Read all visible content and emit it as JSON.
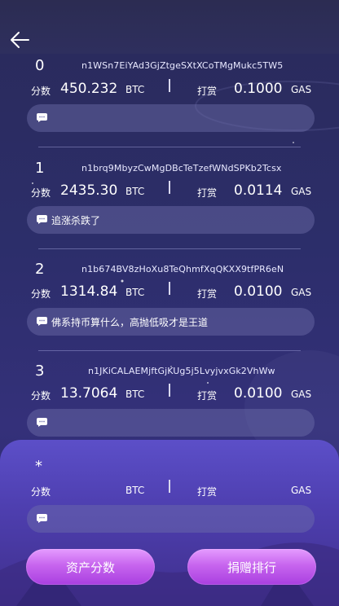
{
  "nav": {
    "back_icon": "arrow-left-icon"
  },
  "labels": {
    "score": "分数",
    "tip": "打赏",
    "btc": "BTC",
    "gas": "GAS"
  },
  "entries": [
    {
      "rank": "0",
      "address": "n1WSn7EiYAd3GjZtgeSXtXCoTMgMukc5TW5",
      "score": "450.232",
      "tip": "0.1000",
      "comment": ""
    },
    {
      "rank": "1",
      "address": "n1brq9MbyzCwMgDBcTeTzefWNdSPKb2Tcsx",
      "score": "2435.30",
      "tip": "0.0114",
      "comment": "追涨杀跌了"
    },
    {
      "rank": "2",
      "address": "n1b674BV8zHoXu8TeQhmfXqQKXX9tfPR6eN",
      "score": "1314.84",
      "tip": "0.0100",
      "comment": "佛系持币算什么，高抛低吸才是王道"
    },
    {
      "rank": "3",
      "address": "n1JKiCALAEMjftGjKUg5j5LvyjvxGk2VhWw",
      "score": "13.7064",
      "tip": "0.0100",
      "comment": ""
    }
  ],
  "mine": {
    "rank": "*",
    "comment": ""
  },
  "buttons": {
    "asset_score": "资产分数",
    "donate_rank": "捐赠排行"
  },
  "colors": {
    "accent": "#c765ee",
    "panel": "#4e3fb0"
  }
}
